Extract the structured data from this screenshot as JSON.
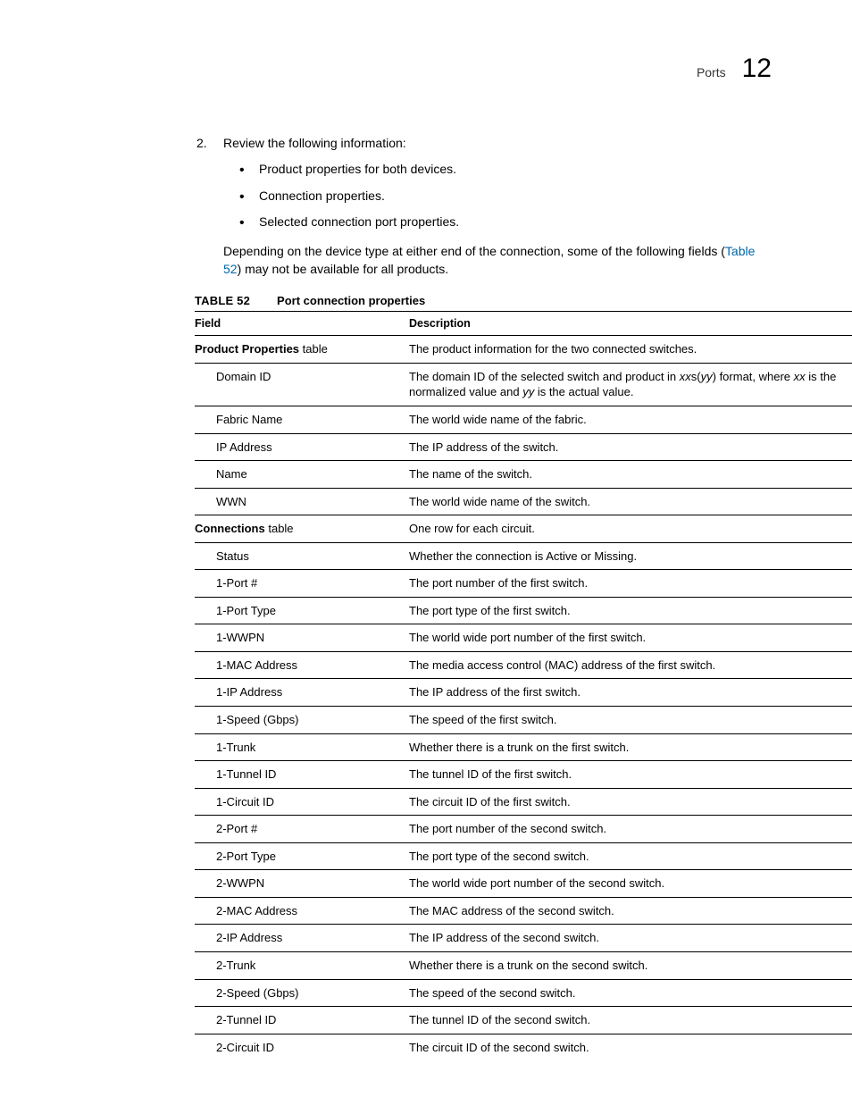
{
  "header": {
    "section": "Ports",
    "chapter": "12"
  },
  "step": {
    "number": "2.",
    "text": "Review the following information:"
  },
  "bullets": {
    "b1": "Product properties for both devices.",
    "b2": "Connection properties.",
    "b3": "Selected connection port properties."
  },
  "para": {
    "before_ref": "Depending on the device type at either end of the connection, some of the following fields (",
    "ref": "Table 52",
    "after_ref": ") may not be available for all products."
  },
  "table": {
    "label": "TABLE 52",
    "title": "Port connection properties",
    "head_field": "Field",
    "head_desc": "Description",
    "groups": {
      "product": {
        "name_bold": "Product Properties",
        "name_suffix": " table",
        "desc": "The product information for the two connected switches."
      },
      "connections": {
        "name_bold": "Connections",
        "name_suffix": " table",
        "desc": "One row for each circuit."
      }
    },
    "rows": {
      "domain_id": {
        "field": "Domain ID",
        "desc_pre": "The domain ID of the selected switch and product in ",
        "italic1": "xx",
        "desc_mid1": "s(",
        "italic2": "yy",
        "desc_mid2": ") format, where ",
        "italic3": "xx",
        "desc_mid3": " is the normalized value and ",
        "italic4": "yy",
        "desc_post": " is the actual value."
      },
      "fabric_name": {
        "field": "Fabric Name",
        "desc": "The world wide name of the fabric."
      },
      "ip_address": {
        "field": "IP Address",
        "desc": "The IP address of the switch."
      },
      "name": {
        "field": "Name",
        "desc": "The name of the switch."
      },
      "wwn": {
        "field": "WWN",
        "desc": "The world wide name of the switch."
      },
      "status": {
        "field": "Status",
        "desc": "Whether the connection is Active or Missing."
      },
      "port1": {
        "field": "1-Port #",
        "desc": "The port number of the first switch."
      },
      "port1type": {
        "field": "1-Port Type",
        "desc": "The port type of the first switch."
      },
      "wwpn1": {
        "field": "1-WWPN",
        "desc": "The world wide port number of the first switch."
      },
      "mac1": {
        "field": "1-MAC Address",
        "desc": "The media access control (MAC) address of the first switch."
      },
      "ip1": {
        "field": "1-IP Address",
        "desc": "The IP address of the first switch."
      },
      "speed1": {
        "field": "1-Speed (Gbps)",
        "desc": "The speed of the first switch."
      },
      "trunk1": {
        "field": "1-Trunk",
        "desc": "Whether there is a trunk on the first switch."
      },
      "tunnel1": {
        "field": "1-Tunnel ID",
        "desc": "The tunnel ID of the first switch."
      },
      "circuit1": {
        "field": "1-Circuit ID",
        "desc": "The circuit ID of the first switch."
      },
      "port2": {
        "field": "2-Port #",
        "desc": "The port number of the second switch."
      },
      "port2type": {
        "field": "2-Port Type",
        "desc": "The port type of the second switch."
      },
      "wwpn2": {
        "field": "2-WWPN",
        "desc": "The world wide port number of the second switch."
      },
      "mac2": {
        "field": "2-MAC Address",
        "desc": "The MAC address of the second switch."
      },
      "ip2": {
        "field": "2-IP Address",
        "desc": "The IP address of the second switch."
      },
      "trunk2": {
        "field": "2-Trunk",
        "desc": "Whether there is a trunk on the second switch."
      },
      "speed2": {
        "field": "2-Speed (Gbps)",
        "desc": "The speed of the second switch."
      },
      "tunnel2": {
        "field": "2-Tunnel ID",
        "desc": "The tunnel ID of the second switch."
      },
      "circuit2": {
        "field": "2-Circuit ID",
        "desc": "The circuit ID of the second switch."
      }
    }
  }
}
